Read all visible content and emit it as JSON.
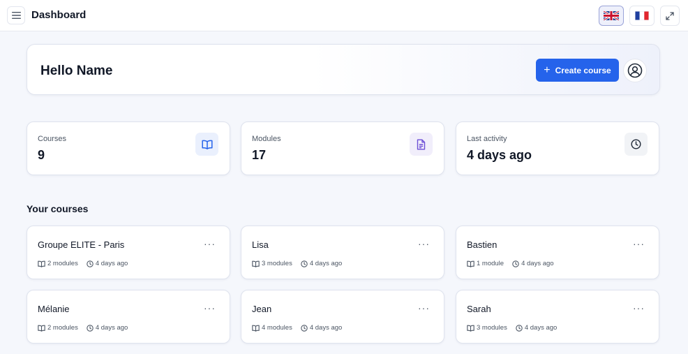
{
  "header": {
    "title": "Dashboard",
    "languages": [
      {
        "code": "en",
        "icon": "uk-flag-icon",
        "active": true
      },
      {
        "code": "fr",
        "icon": "france-flag-icon",
        "active": false
      }
    ]
  },
  "hero": {
    "greeting": "Hello Name",
    "create_label": "Create course"
  },
  "stats": [
    {
      "label": "Courses",
      "value": "9",
      "icon": "book-icon"
    },
    {
      "label": "Modules",
      "value": "17",
      "icon": "document-icon"
    },
    {
      "label": "Last activity",
      "value": "4 days ago",
      "icon": "clock-icon"
    }
  ],
  "courses_section": {
    "title": "Your courses",
    "items": [
      {
        "name": "Groupe ELITE - Paris",
        "modules": "2 modules",
        "updated": "4 days ago"
      },
      {
        "name": "Lisa",
        "modules": "3 modules",
        "updated": "4 days ago"
      },
      {
        "name": "Bastien",
        "modules": "1 module",
        "updated": "4 days ago"
      },
      {
        "name": "Mélanie",
        "modules": "2 modules",
        "updated": "4 days ago"
      },
      {
        "name": "Jean",
        "modules": "4 modules",
        "updated": "4 days ago"
      },
      {
        "name": "Sarah",
        "modules": "3 modules",
        "updated": "4 days ago"
      }
    ],
    "more_glyph": "···"
  },
  "colors": {
    "accent": "#2563eb",
    "background": "#f5f7fc",
    "book_icon_bg": "#eaf0fd",
    "document_icon_bg": "#f1eefb",
    "clock_icon_bg": "#f1f3f6"
  }
}
